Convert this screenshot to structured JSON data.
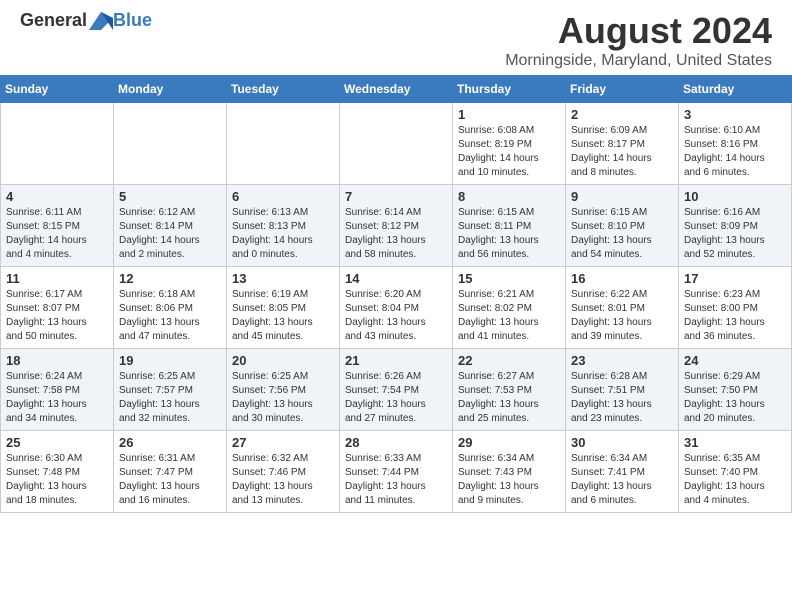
{
  "header": {
    "logo": {
      "general": "General",
      "blue": "Blue"
    },
    "title": "August 2024",
    "location": "Morningside, Maryland, United States"
  },
  "calendar": {
    "days_of_week": [
      "Sunday",
      "Monday",
      "Tuesday",
      "Wednesday",
      "Thursday",
      "Friday",
      "Saturday"
    ],
    "weeks": [
      {
        "days": [
          {
            "number": "",
            "info": ""
          },
          {
            "number": "",
            "info": ""
          },
          {
            "number": "",
            "info": ""
          },
          {
            "number": "",
            "info": ""
          },
          {
            "number": "1",
            "info": "Sunrise: 6:08 AM\nSunset: 8:19 PM\nDaylight: 14 hours\nand 10 minutes."
          },
          {
            "number": "2",
            "info": "Sunrise: 6:09 AM\nSunset: 8:17 PM\nDaylight: 14 hours\nand 8 minutes."
          },
          {
            "number": "3",
            "info": "Sunrise: 6:10 AM\nSunset: 8:16 PM\nDaylight: 14 hours\nand 6 minutes."
          }
        ]
      },
      {
        "days": [
          {
            "number": "4",
            "info": "Sunrise: 6:11 AM\nSunset: 8:15 PM\nDaylight: 14 hours\nand 4 minutes."
          },
          {
            "number": "5",
            "info": "Sunrise: 6:12 AM\nSunset: 8:14 PM\nDaylight: 14 hours\nand 2 minutes."
          },
          {
            "number": "6",
            "info": "Sunrise: 6:13 AM\nSunset: 8:13 PM\nDaylight: 14 hours\nand 0 minutes."
          },
          {
            "number": "7",
            "info": "Sunrise: 6:14 AM\nSunset: 8:12 PM\nDaylight: 13 hours\nand 58 minutes."
          },
          {
            "number": "8",
            "info": "Sunrise: 6:15 AM\nSunset: 8:11 PM\nDaylight: 13 hours\nand 56 minutes."
          },
          {
            "number": "9",
            "info": "Sunrise: 6:15 AM\nSunset: 8:10 PM\nDaylight: 13 hours\nand 54 minutes."
          },
          {
            "number": "10",
            "info": "Sunrise: 6:16 AM\nSunset: 8:09 PM\nDaylight: 13 hours\nand 52 minutes."
          }
        ]
      },
      {
        "days": [
          {
            "number": "11",
            "info": "Sunrise: 6:17 AM\nSunset: 8:07 PM\nDaylight: 13 hours\nand 50 minutes."
          },
          {
            "number": "12",
            "info": "Sunrise: 6:18 AM\nSunset: 8:06 PM\nDaylight: 13 hours\nand 47 minutes."
          },
          {
            "number": "13",
            "info": "Sunrise: 6:19 AM\nSunset: 8:05 PM\nDaylight: 13 hours\nand 45 minutes."
          },
          {
            "number": "14",
            "info": "Sunrise: 6:20 AM\nSunset: 8:04 PM\nDaylight: 13 hours\nand 43 minutes."
          },
          {
            "number": "15",
            "info": "Sunrise: 6:21 AM\nSunset: 8:02 PM\nDaylight: 13 hours\nand 41 minutes."
          },
          {
            "number": "16",
            "info": "Sunrise: 6:22 AM\nSunset: 8:01 PM\nDaylight: 13 hours\nand 39 minutes."
          },
          {
            "number": "17",
            "info": "Sunrise: 6:23 AM\nSunset: 8:00 PM\nDaylight: 13 hours\nand 36 minutes."
          }
        ]
      },
      {
        "days": [
          {
            "number": "18",
            "info": "Sunrise: 6:24 AM\nSunset: 7:58 PM\nDaylight: 13 hours\nand 34 minutes."
          },
          {
            "number": "19",
            "info": "Sunrise: 6:25 AM\nSunset: 7:57 PM\nDaylight: 13 hours\nand 32 minutes."
          },
          {
            "number": "20",
            "info": "Sunrise: 6:25 AM\nSunset: 7:56 PM\nDaylight: 13 hours\nand 30 minutes."
          },
          {
            "number": "21",
            "info": "Sunrise: 6:26 AM\nSunset: 7:54 PM\nDaylight: 13 hours\nand 27 minutes."
          },
          {
            "number": "22",
            "info": "Sunrise: 6:27 AM\nSunset: 7:53 PM\nDaylight: 13 hours\nand 25 minutes."
          },
          {
            "number": "23",
            "info": "Sunrise: 6:28 AM\nSunset: 7:51 PM\nDaylight: 13 hours\nand 23 minutes."
          },
          {
            "number": "24",
            "info": "Sunrise: 6:29 AM\nSunset: 7:50 PM\nDaylight: 13 hours\nand 20 minutes."
          }
        ]
      },
      {
        "days": [
          {
            "number": "25",
            "info": "Sunrise: 6:30 AM\nSunset: 7:48 PM\nDaylight: 13 hours\nand 18 minutes."
          },
          {
            "number": "26",
            "info": "Sunrise: 6:31 AM\nSunset: 7:47 PM\nDaylight: 13 hours\nand 16 minutes."
          },
          {
            "number": "27",
            "info": "Sunrise: 6:32 AM\nSunset: 7:46 PM\nDaylight: 13 hours\nand 13 minutes."
          },
          {
            "number": "28",
            "info": "Sunrise: 6:33 AM\nSunset: 7:44 PM\nDaylight: 13 hours\nand 11 minutes."
          },
          {
            "number": "29",
            "info": "Sunrise: 6:34 AM\nSunset: 7:43 PM\nDaylight: 13 hours\nand 9 minutes."
          },
          {
            "number": "30",
            "info": "Sunrise: 6:34 AM\nSunset: 7:41 PM\nDaylight: 13 hours\nand 6 minutes."
          },
          {
            "number": "31",
            "info": "Sunrise: 6:35 AM\nSunset: 7:40 PM\nDaylight: 13 hours\nand 4 minutes."
          }
        ]
      }
    ]
  }
}
